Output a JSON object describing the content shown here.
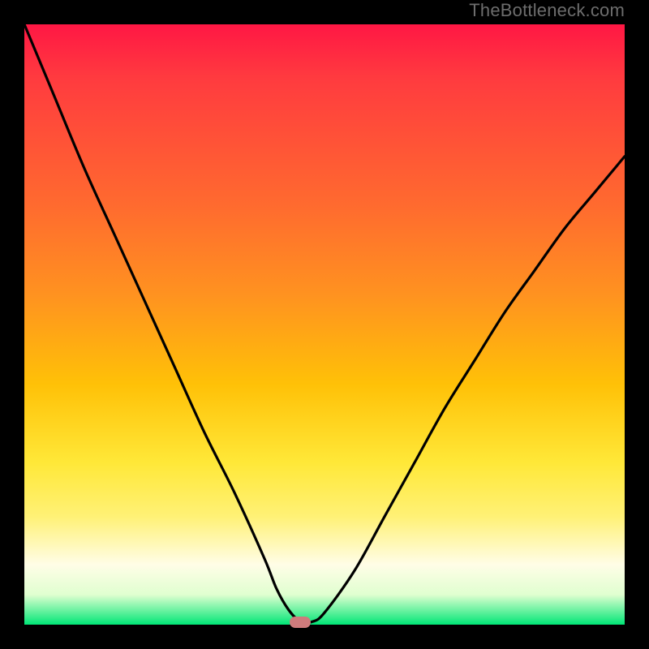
{
  "watermark": "TheBottleneck.com",
  "chart_data": {
    "type": "line",
    "title": "",
    "xlabel": "",
    "ylabel": "",
    "xlim": [
      0,
      100
    ],
    "ylim": [
      0,
      100
    ],
    "grid": false,
    "legend": null,
    "series": [
      {
        "name": "curve",
        "x": [
          0,
          5,
          10,
          15,
          20,
          25,
          30,
          35,
          40,
          42,
          44,
          46,
          48,
          50,
          55,
          60,
          65,
          70,
          75,
          80,
          85,
          90,
          95,
          100
        ],
        "y": [
          100,
          88,
          76,
          65,
          54,
          43,
          32,
          22,
          11,
          6,
          2.5,
          0.5,
          0.5,
          2,
          9,
          18,
          27,
          36,
          44,
          52,
          59,
          66,
          72,
          78
        ]
      }
    ],
    "marker": {
      "shape": "pill",
      "color": "#ce7b7c",
      "x": 46,
      "y": 0
    },
    "background_gradient": [
      "#ff1744",
      "#ff6a2f",
      "#ffc107",
      "#fff176",
      "#00e676"
    ]
  }
}
